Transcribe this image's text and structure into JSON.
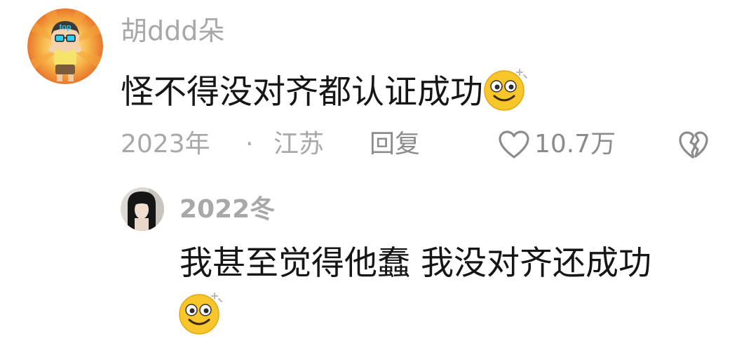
{
  "comment": {
    "username": "胡ddd朵",
    "avatar_text": "top",
    "text": "怪不得没对齐都认证成功",
    "emoji": "dizzy-smile-emoji",
    "time": "2023年",
    "separator": "·",
    "location": "江苏",
    "reply_label": "回复",
    "like_count": "10.7万"
  },
  "reply": {
    "username": "2022冬",
    "text": "我甚至觉得他蠢 我没对齐还成功",
    "emoji": "dizzy-smile-emoji"
  },
  "colors": {
    "username": "#a8a8a8",
    "text": "#161616",
    "meta": "#a8a8a8",
    "emoji_face": "#f7c62b"
  }
}
